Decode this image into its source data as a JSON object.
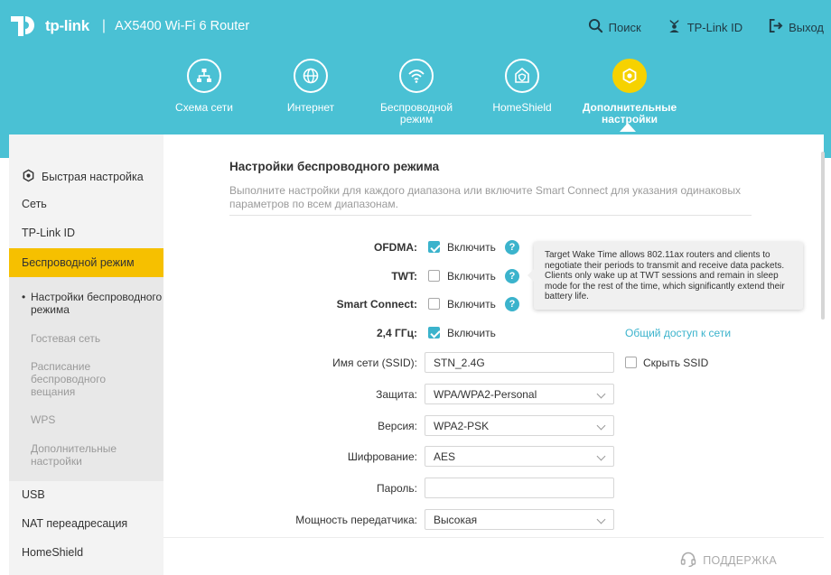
{
  "app": {
    "logo_text": "tp-link",
    "separator": "|",
    "model": "AX5400 Wi-Fi 6 Router"
  },
  "top_actions": [
    {
      "label": "Поиск",
      "icon": "search-icon"
    },
    {
      "label": "TP-Link ID",
      "icon": "tplink-id-icon"
    },
    {
      "label": "Выход",
      "icon": "logout-icon"
    }
  ],
  "nav": [
    {
      "label": "Схема сети",
      "icon": "network-map-icon"
    },
    {
      "label": "Интернет",
      "icon": "globe-icon"
    },
    {
      "label": "Беспроводной режим",
      "icon": "wifi-icon"
    },
    {
      "label": "HomeShield",
      "icon": "home-shield-icon"
    },
    {
      "label": "Дополнительные настройки",
      "icon": "gear-icon",
      "active": true
    }
  ],
  "sidebar": {
    "items": [
      {
        "label": "Быстрая настройка",
        "icon": "gear-icon"
      },
      {
        "label": "Сеть"
      },
      {
        "label": "TP-Link ID"
      },
      {
        "label": "Беспроводной режим",
        "active": true
      },
      {
        "label": "USB"
      },
      {
        "label": "NAT переадресация"
      },
      {
        "label": "HomeShield"
      }
    ],
    "sub_items": [
      {
        "label": "Настройки беспроводного режима",
        "current": true
      },
      {
        "label": "Гостевая сеть"
      },
      {
        "label": "Расписание беспроводного вещания"
      },
      {
        "label": "WPS"
      },
      {
        "label": "Дополнительные настройки"
      }
    ]
  },
  "main": {
    "title": "Настройки беспроводного режима",
    "description": "Выполните настройки для каждого диапазона или включите Smart Connect для указания одинаковых параметров по всем диапазонам.",
    "ofdma": {
      "label": "OFDMA:",
      "checked": true,
      "option": "Включить"
    },
    "twt": {
      "label": "TWT:",
      "checked": false,
      "option": "Включить"
    },
    "smart_connect": {
      "label": "Smart Connect:",
      "checked": false,
      "option": "Включить"
    },
    "band_24": {
      "label": "2,4 ГГц:",
      "checked": true,
      "option": "Включить"
    },
    "share_link": "Общий доступ к сети",
    "ssid": {
      "label": "Имя сети (SSID):",
      "value": "STN_2.4G"
    },
    "hide_ssid": {
      "label": "Скрыть SSID",
      "checked": false
    },
    "security": {
      "label": "Защита:",
      "value": "WPA/WPA2-Personal"
    },
    "version": {
      "label": "Версия:",
      "value": "WPA2-PSK"
    },
    "encryption": {
      "label": "Шифрование:",
      "value": "AES"
    },
    "password": {
      "label": "Пароль:",
      "value": ""
    },
    "tx_power": {
      "label": "Мощность передатчика:",
      "value": "Высокая"
    },
    "help_glyph": "?",
    "tooltip": "Target Wake Time allows 802.11ax routers and clients to negotiate their periods to transmit and receive data packets. Clients only wake up at TWT sessions and remain in sleep mode for the rest of the time, which significantly extend their battery life."
  },
  "footer": {
    "support": "ПОДДЕРЖКА"
  },
  "colors": {
    "header": "#4ac1d4",
    "accent": "#3bb3cc",
    "active": "#f6c000",
    "nav_active": "#f6d200"
  }
}
